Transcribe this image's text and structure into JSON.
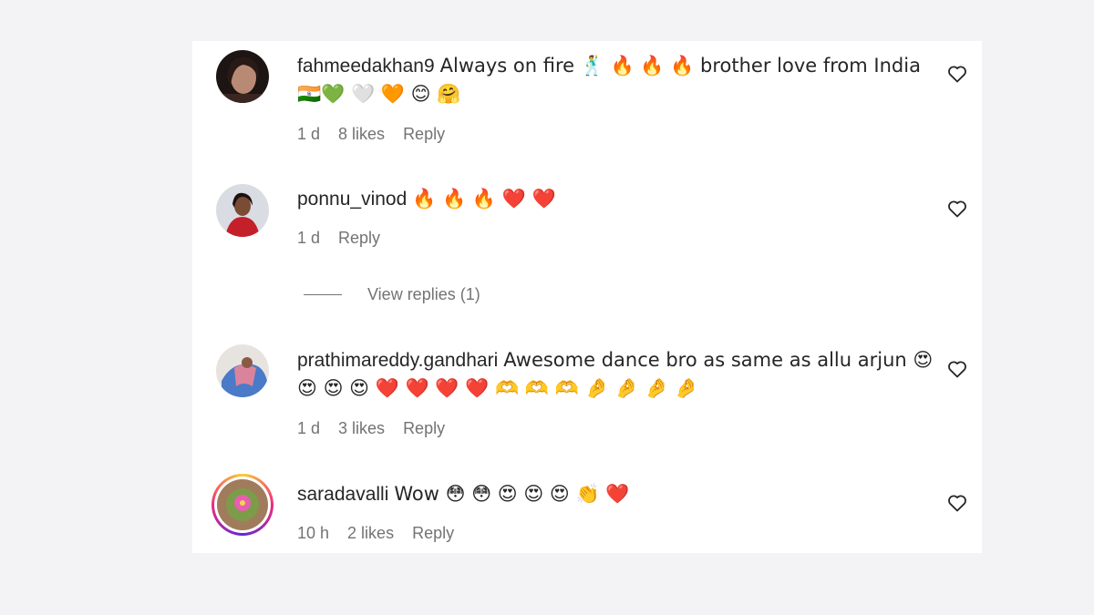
{
  "comments": [
    {
      "username": "fahmeedakhan9",
      "text": "Always on fire 🕺 🔥 🔥 🔥  brother love from India 🇮🇳💚 🤍 🧡 😊 🤗",
      "time": "1 d",
      "likes": "8 likes",
      "reply": "Reply"
    },
    {
      "username": "ponnu_vinod",
      "text": "🔥 🔥 🔥 ❤️ ❤️",
      "time": "1 d",
      "reply": "Reply",
      "view_replies": "View replies (1)"
    },
    {
      "username": "prathimareddy.gandhari",
      "text": "Awesome dance bro as same as allu arjun 😍 😍 😍 😍 ❤️ ❤️ ❤️ ❤️ 🫶 🫶 🫶 🤌 🤌 🤌 🤌",
      "time": "1 d",
      "likes": "3 likes",
      "reply": "Reply"
    },
    {
      "username": "saradavalli",
      "text": "Wow 😳 😳 😍 😍 😍 👏 ❤️",
      "time": "10 h",
      "likes": "2 likes",
      "reply": "Reply"
    }
  ],
  "icons": {
    "like": "heart-outline-icon"
  },
  "colors": {
    "background": "#f3f3f5",
    "panel": "#ffffff",
    "text": "#262626",
    "secondary": "#737373",
    "story_ring": "#ee2a7b"
  }
}
